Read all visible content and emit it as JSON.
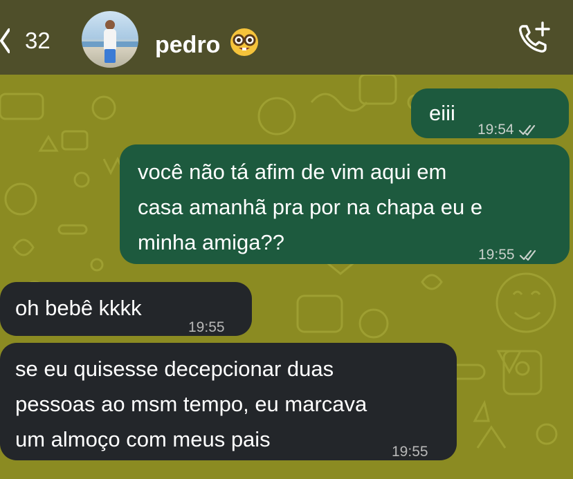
{
  "header": {
    "back_count": "32",
    "contact_name": "pedro",
    "contact_emoji": "nerd-face-emoji",
    "call_icon": "phone-plus-icon",
    "back_icon": "chevron-left-icon"
  },
  "colors": {
    "header_bg": "#4f4f2a",
    "chat_bg": "#8b8b22",
    "outgoing_bubble": "#1d5a3e",
    "incoming_bubble": "#23262a"
  },
  "messages": [
    {
      "direction": "outgoing",
      "text": "eiii",
      "time": "19:54",
      "status": "read-ticks-icon"
    },
    {
      "direction": "outgoing",
      "text": "você não tá afim de vim aqui em\ncasa amanhã pra por na chapa eu e\nminha amiga??",
      "time": "19:55",
      "status": "read-ticks-icon"
    },
    {
      "direction": "incoming",
      "text": "oh bebê kkkk",
      "time": "19:55"
    },
    {
      "direction": "incoming",
      "text": "se eu quisesse decepcionar duas\npessoas ao msm tempo, eu marcava\num almoço com meus pais",
      "time": "19:55"
    }
  ]
}
